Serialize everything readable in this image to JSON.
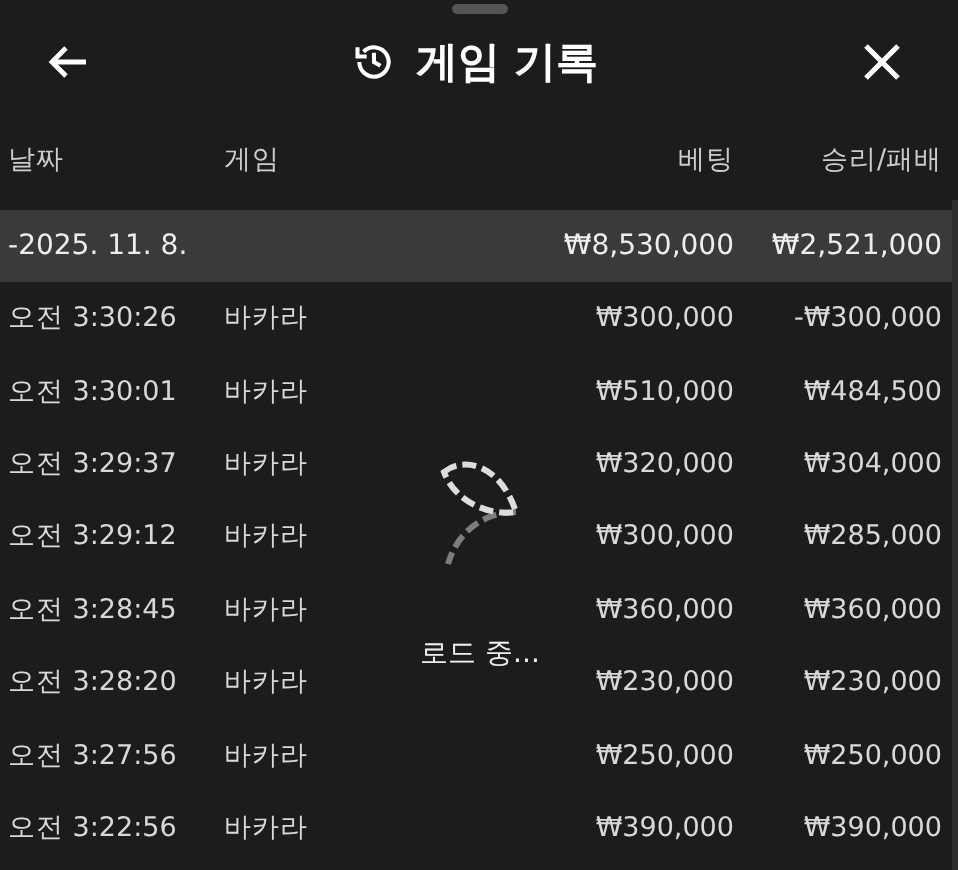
{
  "header": {
    "title": "게임 기록"
  },
  "table": {
    "columns": [
      "날짜",
      "게임",
      "베팅",
      "승리/패배"
    ],
    "group": {
      "toggle": "-",
      "date": "2025. 11. 8.",
      "bet": "₩8,530,000",
      "result": "₩2,521,000",
      "expanded": true
    },
    "rows": [
      {
        "time": "오전 3:30:26",
        "game": "바카라",
        "bet": "₩300,000",
        "result": "-₩300,000"
      },
      {
        "time": "오전 3:30:01",
        "game": "바카라",
        "bet": "₩510,000",
        "result": "₩484,500"
      },
      {
        "time": "오전 3:29:37",
        "game": "바카라",
        "bet": "₩320,000",
        "result": "₩304,000"
      },
      {
        "time": "오전 3:29:12",
        "game": "바카라",
        "bet": "₩300,000",
        "result": "₩285,000"
      },
      {
        "time": "오전 3:28:45",
        "game": "바카라",
        "bet": "₩360,000",
        "result": "₩360,000"
      },
      {
        "time": "오전 3:28:20",
        "game": "바카라",
        "bet": "₩230,000",
        "result": "₩230,000"
      },
      {
        "time": "오전 3:27:56",
        "game": "바카라",
        "bet": "₩250,000",
        "result": "₩250,000"
      },
      {
        "time": "오전 3:22:56",
        "game": "바카라",
        "bet": "₩390,000",
        "result": "₩390,000"
      }
    ]
  },
  "loading": {
    "text": "로드 중..."
  }
}
